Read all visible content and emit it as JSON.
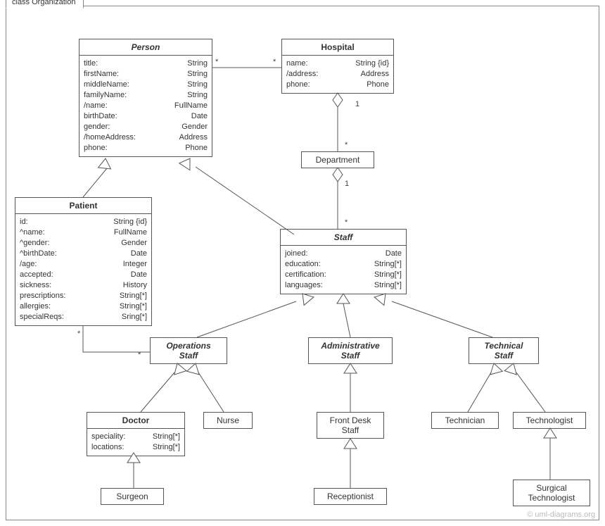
{
  "frame": {
    "title": "class Organization"
  },
  "classes": {
    "person": {
      "title": "Person",
      "attrs": [
        {
          "name": "title:",
          "type": "String"
        },
        {
          "name": "firstName:",
          "type": "String"
        },
        {
          "name": "middleName:",
          "type": "String"
        },
        {
          "name": "familyName:",
          "type": "String"
        },
        {
          "name": "/name:",
          "type": "FullName"
        },
        {
          "name": "birthDate:",
          "type": "Date"
        },
        {
          "name": "gender:",
          "type": "Gender"
        },
        {
          "name": "/homeAddress:",
          "type": "Address"
        },
        {
          "name": "phone:",
          "type": "Phone"
        }
      ]
    },
    "hospital": {
      "title": "Hospital",
      "attrs": [
        {
          "name": "name:",
          "type": "String {id}"
        },
        {
          "name": "/address:",
          "type": "Address"
        },
        {
          "name": "phone:",
          "type": "Phone"
        }
      ]
    },
    "department": {
      "title": "Department"
    },
    "staff": {
      "title": "Staff",
      "attrs": [
        {
          "name": "joined:",
          "type": "Date"
        },
        {
          "name": "education:",
          "type": "String[*]"
        },
        {
          "name": "certification:",
          "type": "String[*]"
        },
        {
          "name": "languages:",
          "type": "String[*]"
        }
      ]
    },
    "patient": {
      "title": "Patient",
      "attrs": [
        {
          "name": "id:",
          "type": "String {id}"
        },
        {
          "name": "^name:",
          "type": "FullName"
        },
        {
          "name": "^gender:",
          "type": "Gender"
        },
        {
          "name": "^birthDate:",
          "type": "Date"
        },
        {
          "name": "/age:",
          "type": "Integer"
        },
        {
          "name": "accepted:",
          "type": "Date"
        },
        {
          "name": "sickness:",
          "type": "History"
        },
        {
          "name": "prescriptions:",
          "type": "String[*]"
        },
        {
          "name": "allergies:",
          "type": "String[*]"
        },
        {
          "name": "specialReqs:",
          "type": "Sring[*]"
        }
      ]
    },
    "operationsStaff": {
      "title": "Operations\nStaff"
    },
    "administrativeStaff": {
      "title": "Administrative\nStaff"
    },
    "technicalStaff": {
      "title": "Technical\nStaff"
    },
    "doctor": {
      "title": "Doctor",
      "attrs": [
        {
          "name": "speciality:",
          "type": "String[*]"
        },
        {
          "name": "locations:",
          "type": "String[*]"
        }
      ]
    },
    "nurse": {
      "title": "Nurse"
    },
    "frontDeskStaff": {
      "title": "Front Desk\nStaff"
    },
    "receptionist": {
      "title": "Receptionist"
    },
    "technician": {
      "title": "Technician"
    },
    "technologist": {
      "title": "Technologist"
    },
    "surgeon": {
      "title": "Surgeon"
    },
    "surgicalTechnologist": {
      "title": "Surgical\nTechnologist"
    }
  },
  "multiplicities": {
    "person_hospital_left": "*",
    "person_hospital_right": "*",
    "hospital_dept_top": "1",
    "hospital_dept_bottom": "*",
    "dept_staff_top": "1",
    "dept_staff_bottom": "*",
    "patient_ops_left": "*",
    "patient_ops_right": "*"
  },
  "watermark": "© uml-diagrams.org"
}
